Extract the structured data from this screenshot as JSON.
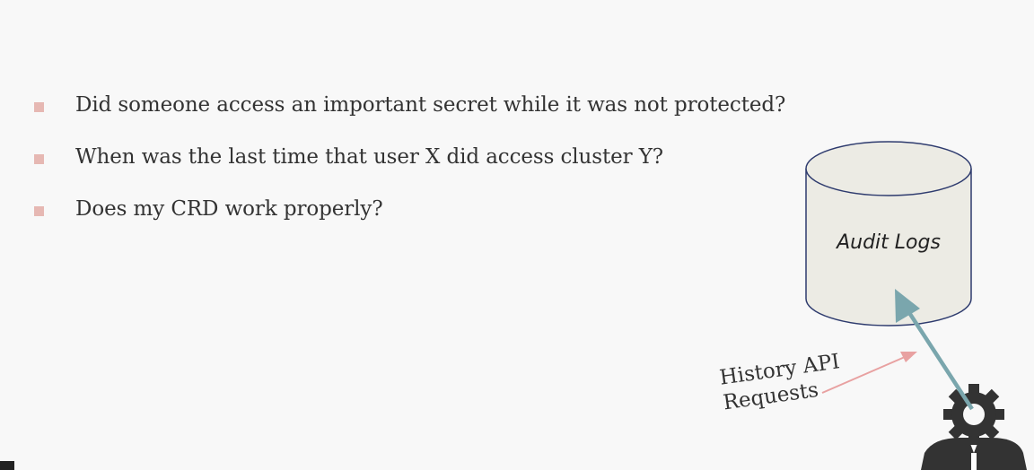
{
  "bullets": [
    "Did someone access an important secret while it was not protected?",
    "When was the last time that user X did access cluster Y?",
    "Does my CRD work properly?"
  ],
  "database": {
    "label": "Audit Logs",
    "fill": "#ecebe4",
    "stroke": "#2e3b6e"
  },
  "requests": {
    "label_line1": "History API",
    "label_line2": "Requests",
    "arrow_color": "#e8a1a1"
  },
  "access_arrow_color": "#7aa6ad",
  "user_icon": "gear-headed-person-icon"
}
